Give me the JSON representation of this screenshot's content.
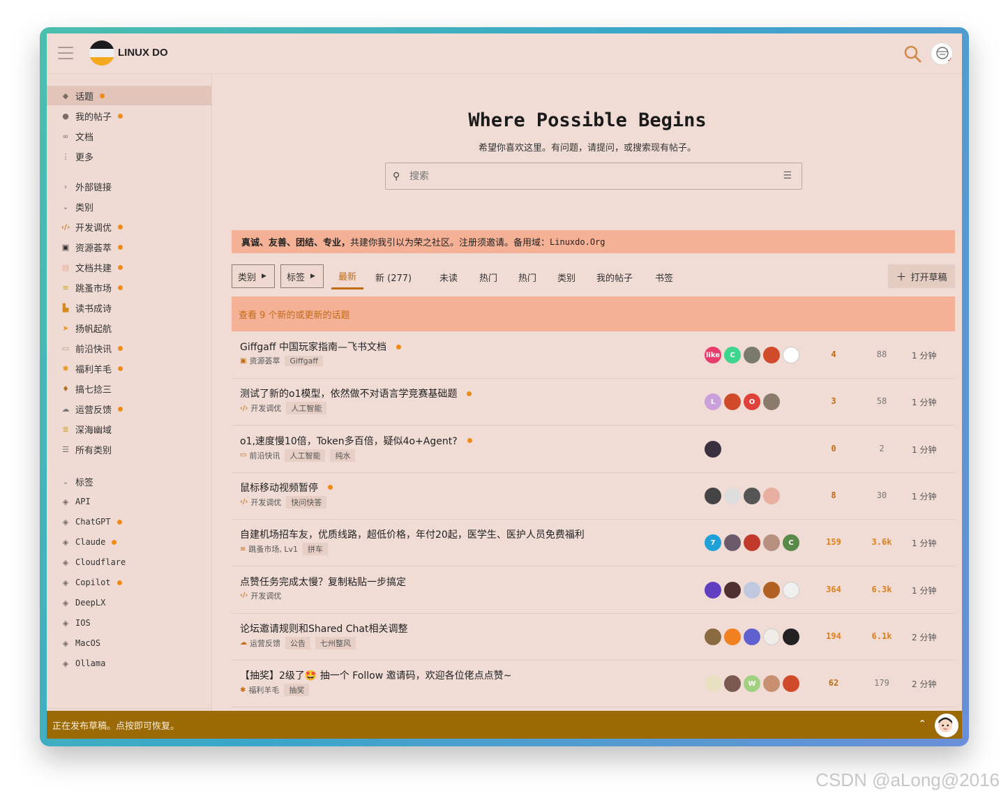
{
  "header": {
    "brand": "LINUX DO"
  },
  "sidebar": {
    "nav": [
      {
        "label": "话题",
        "dot": true
      },
      {
        "label": "我的帖子",
        "dot": true
      },
      {
        "label": "文档",
        "dot": false
      },
      {
        "label": "更多",
        "dot": false
      }
    ],
    "external_links": "外部链接",
    "categories_header": "类别",
    "categories": [
      {
        "label": "开发调优",
        "dot": true
      },
      {
        "label": "资源荟萃",
        "dot": true
      },
      {
        "label": "文档共建",
        "dot": true
      },
      {
        "label": "跳蚤市场",
        "dot": true
      },
      {
        "label": "读书成诗",
        "dot": false
      },
      {
        "label": "扬帆起航",
        "dot": false
      },
      {
        "label": "前沿快讯",
        "dot": true
      },
      {
        "label": "福利羊毛",
        "dot": true
      },
      {
        "label": "搞七捻三",
        "dot": false
      },
      {
        "label": "运营反馈",
        "dot": true
      },
      {
        "label": "深海幽域",
        "dot": false
      },
      {
        "label": "所有类别",
        "dot": false
      }
    ],
    "tags_header": "标签",
    "tags": [
      {
        "label": "API",
        "dot": false
      },
      {
        "label": "ChatGPT",
        "dot": true
      },
      {
        "label": "Claude",
        "dot": true
      },
      {
        "label": "Cloudflare",
        "dot": false
      },
      {
        "label": "Copilot",
        "dot": true
      },
      {
        "label": "DeepLX",
        "dot": false
      },
      {
        "label": "IOS",
        "dot": false
      },
      {
        "label": "MacOS",
        "dot": false
      },
      {
        "label": "Ollama",
        "dot": false
      }
    ]
  },
  "hero": {
    "title": "Where Possible Begins",
    "subtitle": "希望你喜欢这里。有问题，请提问，或搜索现有帖子。",
    "search_placeholder": "搜索"
  },
  "banner": {
    "bold": "真诚、友善、团结、专业，",
    "text": "共建你我引以为荣之社区。注册须邀请。备用域：",
    "domain": "Linuxdo.Org"
  },
  "navbar": {
    "category_dropdown": "类别",
    "tag_dropdown": "标签",
    "tabs": [
      "最新",
      "新 (277)",
      "未读",
      "热门",
      "热门",
      "类别",
      "我的帖子",
      "书签"
    ],
    "draft_button": "打开草稿"
  },
  "new_topics": "查看 9 个新的或更新的话题",
  "topics": [
    {
      "title": "Giffgaff 中国玩家指南—飞书文档",
      "unread": true,
      "category": "资源荟萃",
      "tags": [
        "Giffgaff"
      ],
      "replies": "4",
      "views": "88",
      "time": "1 分钟",
      "hot": false
    },
    {
      "title": "测试了新的o1模型，依然做不对语言学竞赛基础题",
      "unread": true,
      "category": "开发调优",
      "tags": [
        "人工智能"
      ],
      "replies": "3",
      "views": "58",
      "time": "1 分钟",
      "hot": false
    },
    {
      "title": "o1,速度慢10倍，Token多百倍，疑似4o+Agent?",
      "unread": true,
      "category": "前沿快讯",
      "tags": [
        "人工智能",
        "纯水"
      ],
      "replies": "0",
      "views": "2",
      "time": "1 分钟",
      "hot": false
    },
    {
      "title": "鼠标移动视频暂停",
      "unread": true,
      "category": "开发调优",
      "tags": [
        "快问快答"
      ],
      "replies": "8",
      "views": "30",
      "time": "1 分钟",
      "hot": false
    },
    {
      "title": "自建机场招车友，优质线路，超低价格，年付20起，医学生、医护人员免费福利",
      "unread": false,
      "category": "跳蚤市场, Lv1",
      "tags": [
        "拼车"
      ],
      "replies": "159",
      "views": "3.6k",
      "time": "1 分钟",
      "hot": true
    },
    {
      "title": "点赞任务完成太慢？复制粘贴一步搞定",
      "unread": false,
      "category": "开发调优",
      "tags": [],
      "replies": "364",
      "views": "6.3k",
      "time": "1 分钟",
      "hot": true
    },
    {
      "title": "论坛邀请规则和Shared Chat相关调整",
      "unread": false,
      "category": "运营反馈",
      "tags": [
        "公告",
        "七州整风"
      ],
      "replies": "194",
      "views": "6.1k",
      "time": "2 分钟",
      "hot": true
    },
    {
      "title": "【抽奖】2级了🤩 抽一个 Follow 邀请码，欢迎各位佬点点赞~",
      "unread": false,
      "category": "福利羊毛",
      "tags": [
        "抽奖"
      ],
      "replies": "62",
      "views": "179",
      "time": "2 分钟",
      "hot": false
    }
  ],
  "footer": {
    "text": "正在发布草稿。点按即可恢复。"
  },
  "watermark": "CSDN @aLong@2016",
  "colors": {
    "accent": "#c26a14",
    "unread_dot": "#f08a18",
    "banner_bg": "#f5b196",
    "footer_bg": "#9c6a05",
    "bg": "#f0dcd5"
  }
}
